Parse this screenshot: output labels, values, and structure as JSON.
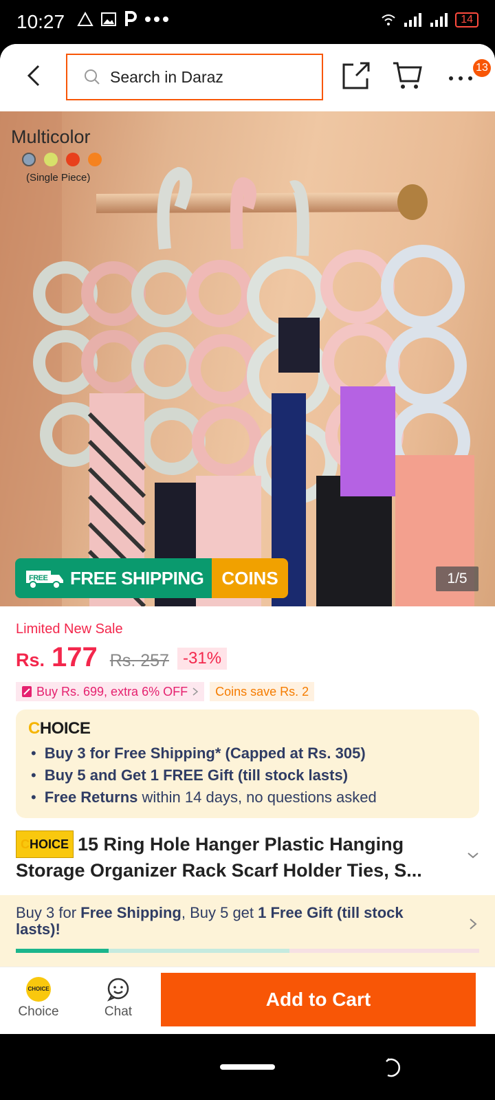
{
  "status_bar": {
    "time": "10:27",
    "battery": "14"
  },
  "header": {
    "search_placeholder": "Search in Daraz",
    "more_badge": "13"
  },
  "hero": {
    "variant_title": "Multicolor",
    "variant_note": "(Single Piece)",
    "swatch_colors": [
      "#8aa0b8",
      "#d7e06a",
      "#e8401c",
      "#f5821f"
    ],
    "shipping_badge": "FREE SHIPPING",
    "shipping_badge_icon_text": "FREE",
    "coins_badge": "COINS",
    "pager": "1/5"
  },
  "price": {
    "label": "Limited New Sale",
    "currency": "Rs.",
    "amount": "177",
    "old_price": "Rs. 257",
    "discount": "-31%",
    "promo_voucher": "Buy Rs. 699, extra 6% OFF",
    "promo_coins": "Coins save Rs. 2"
  },
  "choice": {
    "logo": "CHOICE",
    "items": [
      {
        "bold": "Buy 3 for  Free Shipping* (Capped at Rs. 305)",
        "rest": ""
      },
      {
        "bold": "Buy 5 and Get 1 FREE Gift (till stock lasts)",
        "rest": ""
      },
      {
        "bold": "Free Returns",
        "rest": " within 14 days, no questions asked"
      }
    ]
  },
  "product": {
    "tag": "CHOICE",
    "title": "15 Ring Hole Hanger Plastic Hanging Storage Organizer Rack Scarf Holder Ties, S..."
  },
  "shipping_bar": {
    "t1": "Buy 3 for ",
    "b1": "Free Shipping",
    "t2": ", Buy 5 get ",
    "b2": "1 Free Gift (till stock lasts)!",
    "progress_done": 0.2,
    "progress_next": 0.59
  },
  "bottom": {
    "choice_label": "Choice",
    "choice_coin_text": "CHOICE",
    "chat_label": "Chat",
    "add_to_cart": "Add to Cart"
  }
}
